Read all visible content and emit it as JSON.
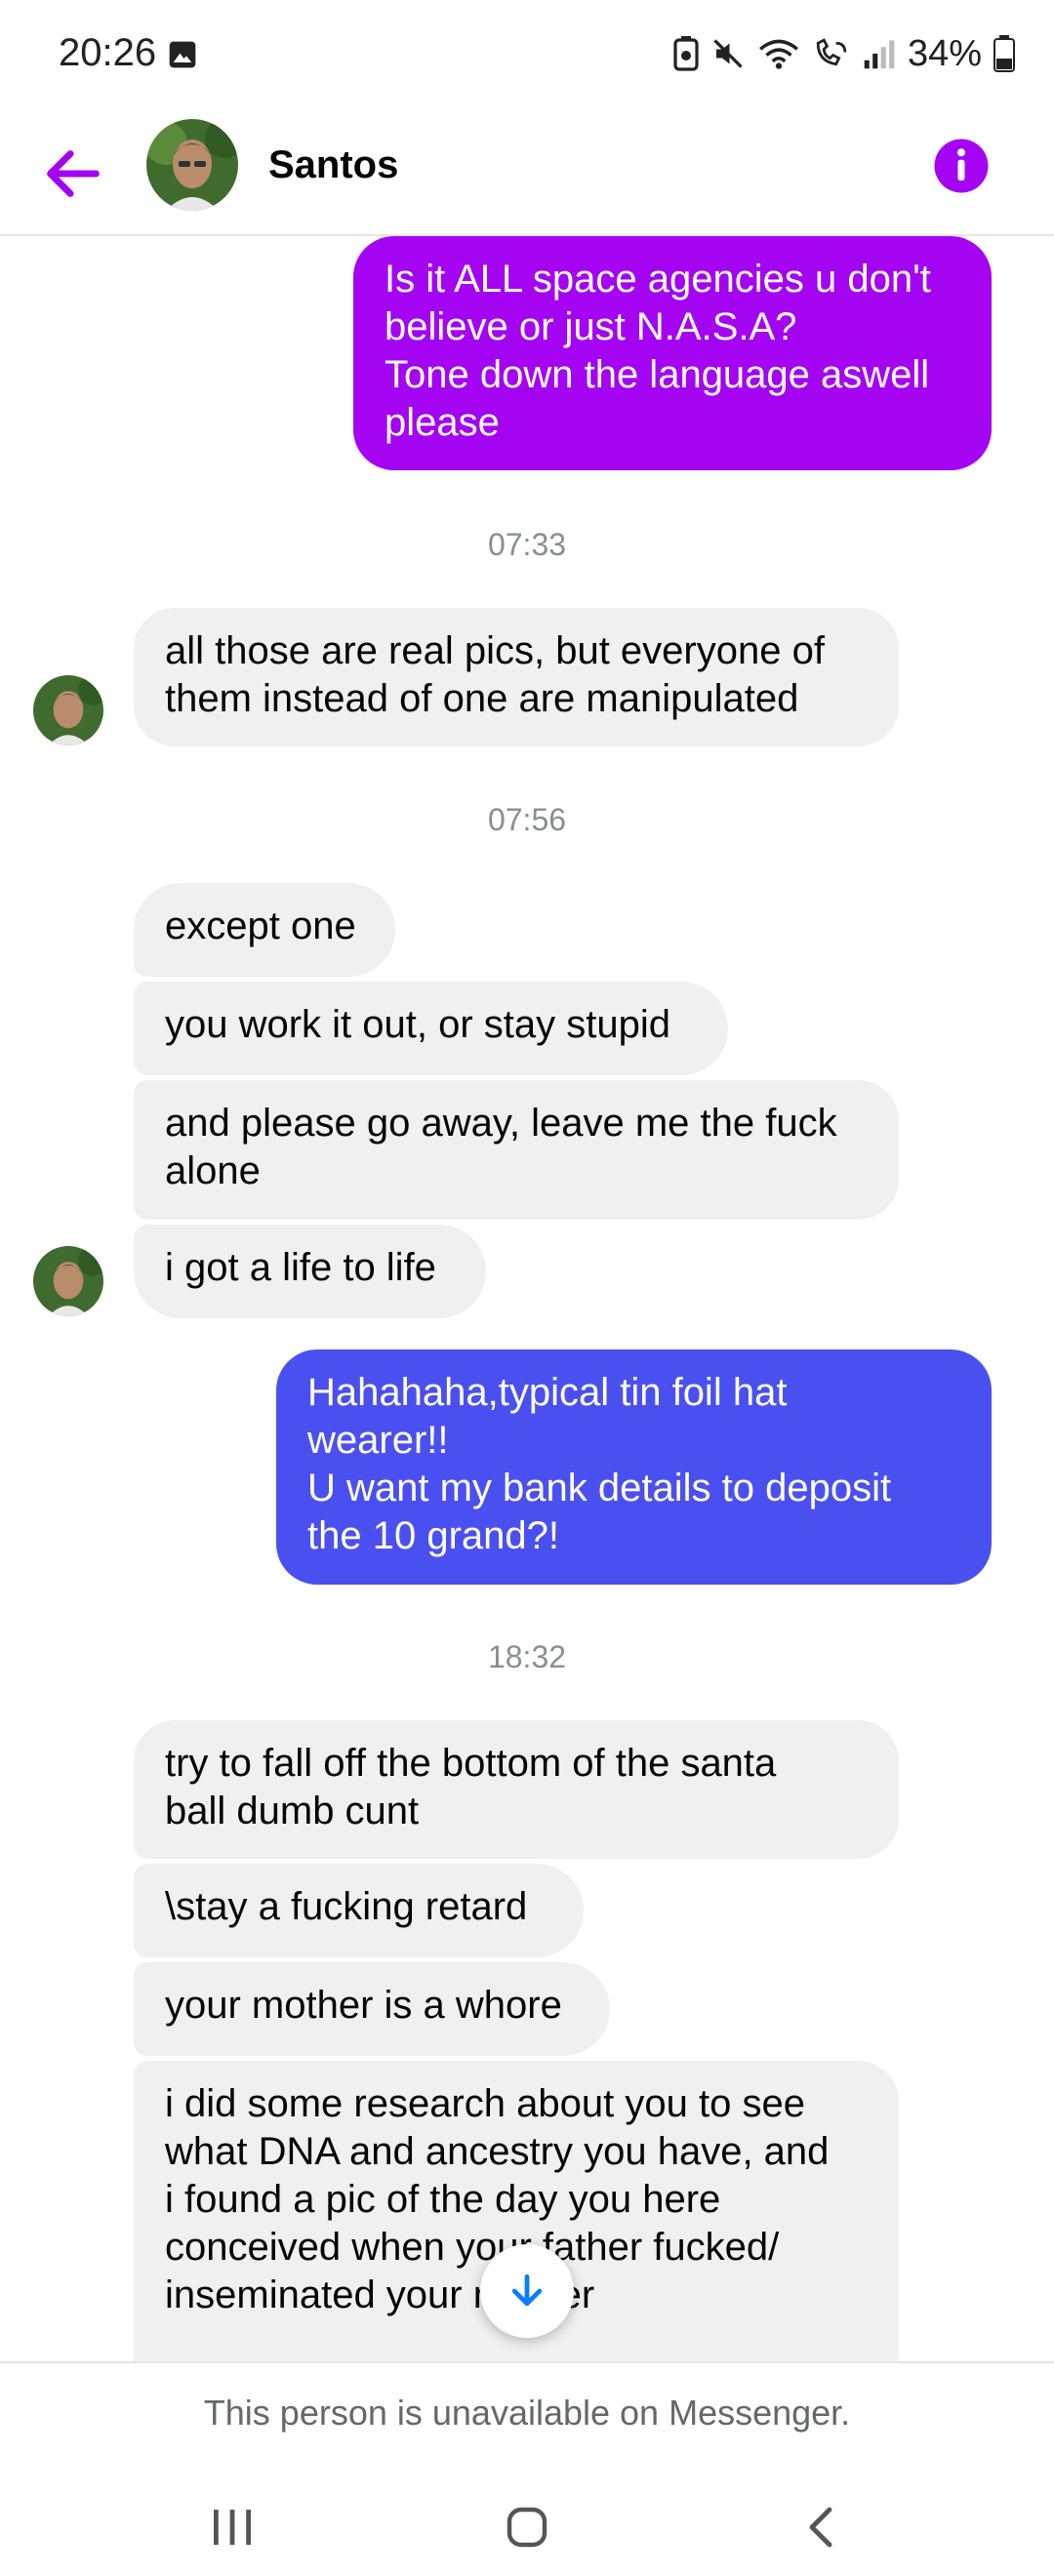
{
  "status_bar": {
    "time": "20:26",
    "battery_percent": "34%",
    "icons": [
      "gallery-icon",
      "battery-saver-icon",
      "mute-icon",
      "wifi-icon",
      "wifi-calling-icon",
      "signal-icon",
      "battery-icon"
    ]
  },
  "header": {
    "contact_name": "Santos",
    "accent_color": "#a404f2"
  },
  "messages": [
    {
      "from": "me",
      "text": "Is it ALL space agencies u don't\nbelieve or just N.A.S.A?\nTone down the language aswell\nplease"
    },
    {
      "type": "timestamp",
      "text": "07:33"
    },
    {
      "from": "them",
      "text": "all those are real pics, but everyone of\nthem instead of one are manipulated"
    },
    {
      "type": "timestamp",
      "text": "07:56"
    },
    {
      "from": "them",
      "text": "except one"
    },
    {
      "from": "them",
      "text": "you work it out, or stay stupid"
    },
    {
      "from": "them",
      "text": "and please go away, leave me the fuck\nalone"
    },
    {
      "from": "them",
      "text": "i got a life to life"
    },
    {
      "from": "me",
      "text": "Hahahaha,typical tin foil hat\nwearer!!\nU want my bank details to deposit\nthe 10 grand?!"
    },
    {
      "type": "timestamp",
      "text": "18:32"
    },
    {
      "from": "them",
      "text": "try to fall off the bottom of the santa\nball dumb cunt"
    },
    {
      "from": "them",
      "text": "\\stay a fucking retard"
    },
    {
      "from": "them",
      "text": "your mother is a whore"
    },
    {
      "from": "them",
      "text": "i did some research about you to see\nwhat DNA and ancestry you have, and\ni found a pic of the day you here\nconceived when your father fucked/\ninseminated your mother"
    }
  ],
  "colors": {
    "outgoing_purple": "#a404f2",
    "outgoing_blue": "#4a50f0",
    "incoming_gray": "#f0f0f0"
  },
  "footer": {
    "text": "This person is unavailable on Messenger."
  },
  "nav": {
    "icons": [
      "recent-apps-icon",
      "home-icon",
      "back-icon"
    ]
  }
}
